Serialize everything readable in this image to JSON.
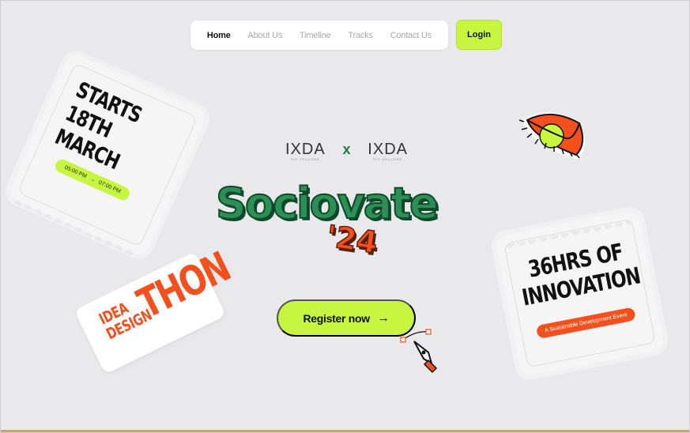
{
  "nav": {
    "items": [
      {
        "label": "Home",
        "active": true
      },
      {
        "label": "About Us",
        "active": false
      },
      {
        "label": "Timeline",
        "active": false
      },
      {
        "label": "Tracks",
        "active": false
      },
      {
        "label": "Contact Us",
        "active": false
      }
    ],
    "login_label": "Login"
  },
  "card_left": {
    "headline_line1": "STARTS 18TH",
    "headline_line2": "MARCH",
    "time_start": "05:00 PM",
    "time_end": "07:00 PM",
    "arrow": "→"
  },
  "sticker_ideathon": {
    "small_line1": "IDEA",
    "small_line2": "DESIGN",
    "big": "THON"
  },
  "brand": {
    "left": "IXDA",
    "separator": "x",
    "right": "IXDA",
    "left_sub": "VIT VELLORE",
    "right_sub": "VIT VELLORE"
  },
  "logo": {
    "word": "Sociovate",
    "year": "'24"
  },
  "cta": {
    "register_label": "Register now",
    "arrow": "→"
  },
  "card_right": {
    "headline_line1": "36HRS OF",
    "headline_line2": "INNOVATION",
    "tag": "A Sustainable Development Event"
  },
  "colors": {
    "accent_lime": "#c7f540",
    "accent_orange": "#f4501e",
    "brand_green": "#2b8f56",
    "background": "#e9e8ea"
  }
}
